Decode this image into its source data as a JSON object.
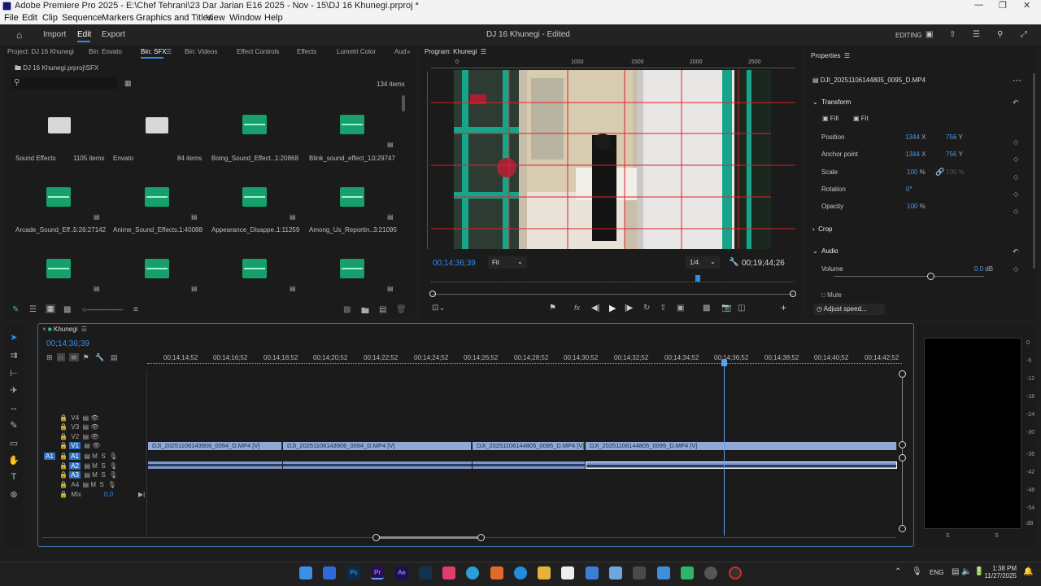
{
  "window": {
    "title": "Adobe Premiere Pro 2025 - E:\\Chef Tehrani\\23 Dar Jarian E16 2025 - Nov - 15\\DJ 16 Khunegi.prproj *"
  },
  "menu": [
    "File",
    "Edit",
    "Clip",
    "Sequence",
    "Markers",
    "Graphics and Titles",
    "View",
    "Window",
    "Help"
  ],
  "topbar": {
    "import": "Import",
    "edit": "Edit",
    "export": "Export",
    "project": "DJ 16 Khunegi",
    "status": "- Edited",
    "workspace": "EDITING"
  },
  "project_panel": {
    "tabs": [
      "Project: DJ 16 Khunegi",
      "Bin: Envato",
      "Bin: SFX",
      "Bin: Videos",
      "Effect Controls",
      "Effects",
      "Lumetri Color",
      "Aud"
    ],
    "path": "DJ 16 Khunegi.prproj\\SFX",
    "search_placeholder": "",
    "item_count": "134 items",
    "items": [
      {
        "name": "Sound Effects",
        "meta": "1105 items"
      },
      {
        "name": "Envato",
        "meta": "84 items"
      },
      {
        "name": "Boing_Sound_Effect...",
        "meta": "1:20868"
      },
      {
        "name": "Blink_sound_effect_1...",
        "meta": "0:29747"
      },
      {
        "name": "Arcade_Sound_Eff...",
        "meta": "5:26:27142"
      },
      {
        "name": "Anime_Sound_Effects...",
        "meta": "1:40088"
      },
      {
        "name": "Appearance_Disappe...",
        "meta": "1:11259"
      },
      {
        "name": "Among_Us_Reportin...",
        "meta": "3:21095"
      }
    ]
  },
  "program_monitor": {
    "tab": "Program: Khunegi",
    "ruler": [
      "0",
      "1000",
      "1500",
      "2000",
      "2500"
    ],
    "timecode": "00;14;36;39",
    "fit": "Fit",
    "resolution": "1/4",
    "duration": "00;19;44;26"
  },
  "properties": {
    "tab": "Properties",
    "clip": "DJI_20251106144805_0095_D.MP4",
    "transform": "Transform",
    "fill": "Fill",
    "fit": "Fit",
    "rows": [
      {
        "label": "Position",
        "v1": "1344",
        "u1": "X",
        "v2": "756",
        "u2": "Y"
      },
      {
        "label": "Anchor point",
        "v1": "1344",
        "u1": "X",
        "v2": "756",
        "u2": "Y"
      },
      {
        "label": "Scale",
        "v1": "100",
        "u1": "%",
        "v2": "100",
        "u2": "%"
      },
      {
        "label": "Rotation",
        "v1": "0",
        "u1": "°",
        "v2": "",
        "u2": ""
      },
      {
        "label": "Opacity",
        "v1": "100",
        "u1": "%",
        "v2": "",
        "u2": ""
      }
    ],
    "crop": "Crop",
    "audio": "Audio",
    "volume_label": "Volume",
    "volume_value": "0.0",
    "volume_unit": "dB",
    "mute": "Mute",
    "adjust_speed": "Adjust speed..."
  },
  "timeline": {
    "tab": "Khunegi",
    "timecode": "00;14;36;39",
    "ruler": [
      "00;14;14;52",
      "00;14;16;52",
      "00;14;18;52",
      "00;14;20;52",
      "00;14;22;52",
      "00;14;24;52",
      "00;14;26;52",
      "00;14;28;52",
      "00;14;30;52",
      "00;14;32;52",
      "00;14;34;52",
      "00;14;36;52",
      "00;14;38;52",
      "00;14;40;52",
      "00;14;42;52"
    ],
    "video_tracks": [
      "V4",
      "V3",
      "V2",
      "V1"
    ],
    "audio_tracks": [
      "A1",
      "A2",
      "A3",
      "A4"
    ],
    "mix_label": "Mix",
    "mix_value": "0.0",
    "clips": [
      {
        "name": "DJI_20251106143906_0094_D.MP4 [V]"
      },
      {
        "name": "DJI_20251106143906_0094_D.MP4 [V]"
      },
      {
        "name": "DJI_20251106144805_0095_D.MP4 [V]"
      },
      {
        "name": "DJI_20251106144805_0095_D.MP4 [V]"
      }
    ]
  },
  "meter": {
    "scale": [
      "0",
      "-6",
      "-12",
      "-18",
      "-24",
      "-30",
      "-36",
      "-42",
      "-48",
      "-54",
      "dB"
    ],
    "channels": [
      "S",
      "S"
    ]
  },
  "taskbar": {
    "lang": "ENG",
    "time": "1:38 PM",
    "date": "11/27/2025"
  },
  "colors": {
    "accent": "#2d8ceb",
    "clip_video": "#8fa8d6",
    "clip_audio": "#7e98c8",
    "waveform": "#17a06c"
  }
}
